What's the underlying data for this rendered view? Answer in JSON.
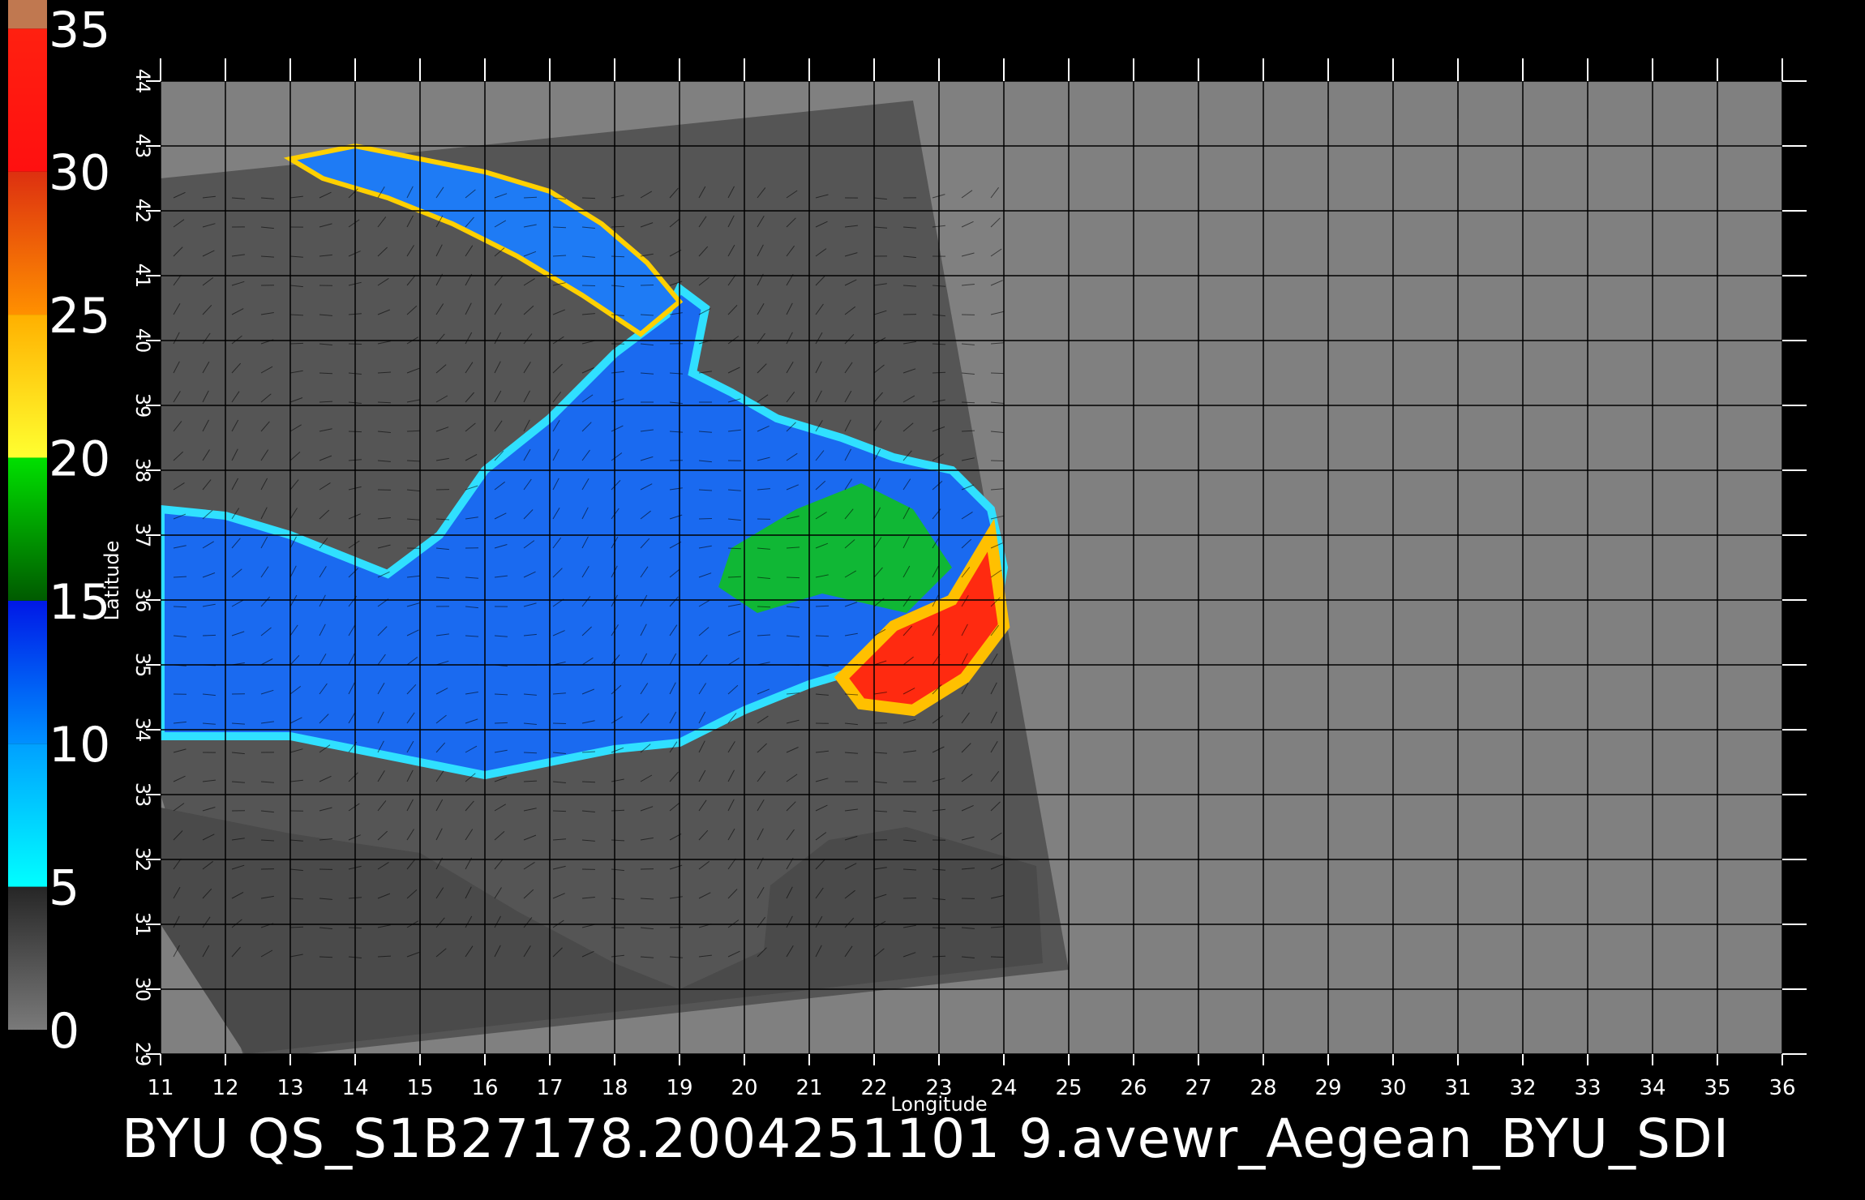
{
  "caption": "BYU  QS_S1B27178.2004251101 9.avewr_Aegean_BYU_SDI",
  "x_axis": {
    "label": "Longitude",
    "range": [
      11,
      36
    ],
    "ticks": [
      "11",
      "12",
      "13",
      "14",
      "15",
      "16",
      "17",
      "18",
      "19",
      "20",
      "21",
      "22",
      "23",
      "24",
      "25",
      "26",
      "27",
      "28",
      "29",
      "30",
      "31",
      "32",
      "33",
      "34",
      "35",
      "36"
    ]
  },
  "y_axis": {
    "label": "Latitude",
    "range": [
      29,
      44
    ],
    "ticks": [
      "29",
      "30",
      "31",
      "32",
      "33",
      "34",
      "35",
      "36",
      "37",
      "38",
      "39",
      "40",
      "41",
      "42",
      "43",
      "44"
    ]
  },
  "colorbar": {
    "labels": [
      "0",
      "5",
      "10",
      "15",
      "20",
      "25",
      "30",
      "35"
    ],
    "range": [
      0,
      35
    ],
    "bands": [
      {
        "from": 0,
        "to": 5,
        "colors": [
          "#7a7a7a",
          "#262626"
        ]
      },
      {
        "from": 5,
        "to": 10,
        "colors": [
          "#00ffff",
          "#00a0ff"
        ]
      },
      {
        "from": 10,
        "to": 15,
        "colors": [
          "#0090ff",
          "#0018e6"
        ]
      },
      {
        "from": 15,
        "to": 20,
        "colors": [
          "#005a00",
          "#00e000"
        ]
      },
      {
        "from": 20,
        "to": 25,
        "colors": [
          "#ffff30",
          "#ffb000"
        ]
      },
      {
        "from": 25,
        "to": 30,
        "colors": [
          "#ff9000",
          "#dd3010"
        ]
      },
      {
        "from": 30,
        "to": 35,
        "colors": [
          "#ff1010",
          "#ff2010"
        ]
      },
      {
        "from": 35,
        "to": 36,
        "colors": [
          "#c07850",
          "#c07850"
        ]
      }
    ]
  },
  "colors": {
    "background": "#000000",
    "plot_gray": "#808080",
    "swath_gray": "#555555",
    "land_mask": "#4a4a4a",
    "grid": "#000000",
    "text": "#ffffff"
  },
  "map": {
    "swath_corners_lonlat": [
      [
        11,
        42.5
      ],
      [
        22.6,
        43.7
      ],
      [
        25.0,
        30.3
      ],
      [
        12.3,
        28.9
      ],
      [
        11,
        33.0
      ]
    ],
    "coast_northwest_lonlat": [
      [
        11,
        42.4
      ],
      [
        11.8,
        42.2
      ],
      [
        12.7,
        41.2
      ],
      [
        13.4,
        40.9
      ],
      [
        14.3,
        40.6
      ],
      [
        15.0,
        40.2
      ],
      [
        15.6,
        40.0
      ],
      [
        16.0,
        39.0
      ],
      [
        15.8,
        38.4
      ],
      [
        15.3,
        38.1
      ],
      [
        14.3,
        38.1
      ],
      [
        13.2,
        38.0
      ],
      [
        12.3,
        37.9
      ],
      [
        11,
        37.4
      ]
    ],
    "coast_south_lonlat": [
      [
        11,
        33.0
      ],
      [
        12.0,
        32.8
      ],
      [
        13.0,
        32.6
      ],
      [
        14.0,
        32.5
      ],
      [
        15.0,
        32.3
      ],
      [
        16.0,
        31.6
      ],
      [
        17.0,
        31.0
      ],
      [
        18.0,
        30.6
      ],
      [
        19.0,
        30.3
      ],
      [
        20.0,
        30.8
      ],
      [
        20.2,
        31.5
      ],
      [
        21.0,
        32.5
      ],
      [
        22.0,
        32.8
      ],
      [
        23.0,
        32.4
      ],
      [
        24.5,
        32.0
      ],
      [
        24.8,
        32.3
      ],
      [
        24.5,
        33.4
      ],
      [
        24.0,
        34.6
      ],
      [
        23.5,
        35.0
      ],
      [
        22.5,
        34.6
      ],
      [
        21.5,
        34.0
      ],
      [
        20.5,
        33.6
      ],
      [
        19.5,
        33.4
      ],
      [
        18.5,
        33.5
      ],
      [
        17.5,
        33.3
      ],
      [
        16.5,
        33.0
      ],
      [
        15.5,
        33.1
      ],
      [
        14.0,
        33.3
      ],
      [
        12.5,
        33.6
      ],
      [
        11,
        33.6
      ]
    ],
    "sea_central_lonlat": [
      [
        11,
        37.4
      ],
      [
        12.0,
        37.3
      ],
      [
        13.0,
        37.0
      ],
      [
        14.5,
        36.4
      ],
      [
        15.3,
        37.0
      ],
      [
        16.0,
        38.0
      ],
      [
        17.0,
        38.8
      ],
      [
        18.0,
        39.8
      ],
      [
        18.8,
        40.4
      ],
      [
        19.0,
        40.8
      ],
      [
        19.4,
        40.5
      ],
      [
        19.2,
        39.5
      ],
      [
        19.8,
        39.2
      ],
      [
        20.5,
        38.8
      ],
      [
        21.5,
        38.5
      ],
      [
        22.3,
        38.2
      ],
      [
        23.2,
        38.0
      ],
      [
        23.8,
        37.4
      ],
      [
        24.0,
        36.5
      ],
      [
        23.8,
        35.4
      ],
      [
        23.0,
        35.3
      ],
      [
        22.0,
        35.0
      ],
      [
        21.0,
        34.7
      ],
      [
        20.0,
        34.3
      ],
      [
        19.0,
        33.8
      ],
      [
        18.0,
        33.7
      ],
      [
        17.0,
        33.5
      ],
      [
        16.0,
        33.3
      ],
      [
        14.5,
        33.6
      ],
      [
        13.0,
        33.9
      ],
      [
        11,
        33.9
      ]
    ],
    "sea_adriatic_lonlat": [
      [
        13.0,
        42.8
      ],
      [
        14.0,
        43.0
      ],
      [
        15.0,
        42.8
      ],
      [
        16.0,
        42.6
      ],
      [
        17.0,
        42.3
      ],
      [
        17.8,
        41.8
      ],
      [
        18.5,
        41.2
      ],
      [
        19.0,
        40.6
      ],
      [
        18.4,
        40.1
      ],
      [
        17.5,
        40.7
      ],
      [
        16.5,
        41.3
      ],
      [
        15.5,
        41.8
      ],
      [
        14.5,
        42.2
      ],
      [
        13.5,
        42.5
      ]
    ]
  }
}
